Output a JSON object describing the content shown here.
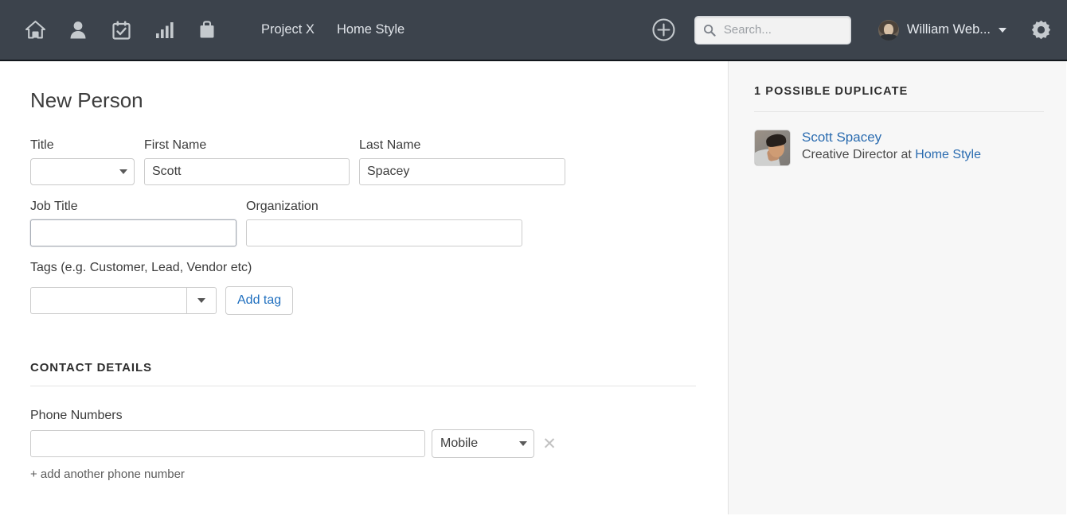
{
  "topbar": {
    "icons": [
      {
        "name": "home-icon",
        "label": "Home"
      },
      {
        "name": "person-icon",
        "label": "People"
      },
      {
        "name": "calendar-check-icon",
        "label": "Tasks"
      },
      {
        "name": "bar-chart-icon",
        "label": "Reports"
      },
      {
        "name": "briefcase-icon",
        "label": "Projects"
      }
    ],
    "links": [
      {
        "label": "Project X"
      },
      {
        "label": "Home Style"
      }
    ],
    "add_icon": "plus-circle-icon",
    "search": {
      "icon": "search-icon",
      "placeholder": "Search...",
      "value": ""
    },
    "user": {
      "name": "William Web...",
      "avatar": "user-avatar",
      "caret": "chevron-down-icon"
    },
    "settings_icon": "gear-icon"
  },
  "main": {
    "title": "New Person",
    "fields": {
      "title": {
        "label": "Title",
        "value": ""
      },
      "first_name": {
        "label": "First Name",
        "value": "Scott"
      },
      "last_name": {
        "label": "Last Name",
        "value": "Spacey"
      },
      "job_title": {
        "label": "Job Title",
        "value": ""
      },
      "organization": {
        "label": "Organization",
        "value": ""
      }
    },
    "tags": {
      "label": "Tags (e.g. Customer, Lead, Vendor etc)",
      "value": "",
      "add_button": "Add tag"
    },
    "contact_details": {
      "heading": "CONTACT DETAILS",
      "phone": {
        "label": "Phone Numbers",
        "value": "",
        "type": "Mobile",
        "remove_icon": "close-icon",
        "add_another": "+ add another phone number"
      }
    }
  },
  "sidebar": {
    "heading": "1 POSSIBLE DUPLICATE",
    "duplicate": {
      "name": "Scott Spacey",
      "role_prefix": "Creative Director at ",
      "organization": "Home Style",
      "avatar": "contact-photo"
    }
  },
  "colors": {
    "topbar_bg": "#3c434c",
    "link_blue": "#2b6cb0",
    "sidebar_bg": "#f7f7f7",
    "border_gray": "#cccccc"
  }
}
